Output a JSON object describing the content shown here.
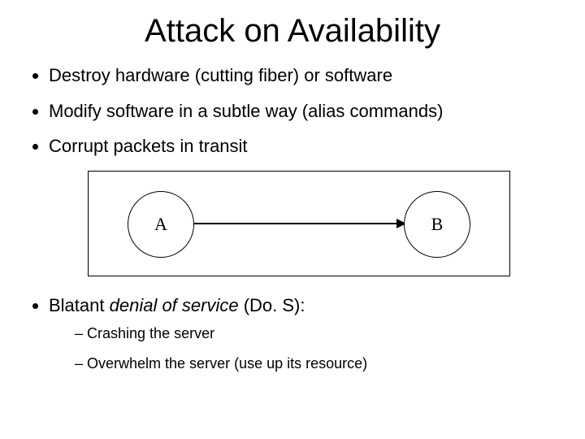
{
  "title": "Attack on Availability",
  "bullets": {
    "b1": "Destroy hardware (cutting fiber) or software",
    "b2": "Modify software in a subtle way (alias commands)",
    "b3": "Corrupt packets in transit",
    "b4_prefix": "Blatant ",
    "b4_em": "denial of service",
    "b4_suffix": " (Do. S):",
    "sub1": "Crashing the server",
    "sub2": "Overwhelm the server (use up its resource)"
  },
  "diagram": {
    "node_a": "A",
    "node_b": "B"
  }
}
